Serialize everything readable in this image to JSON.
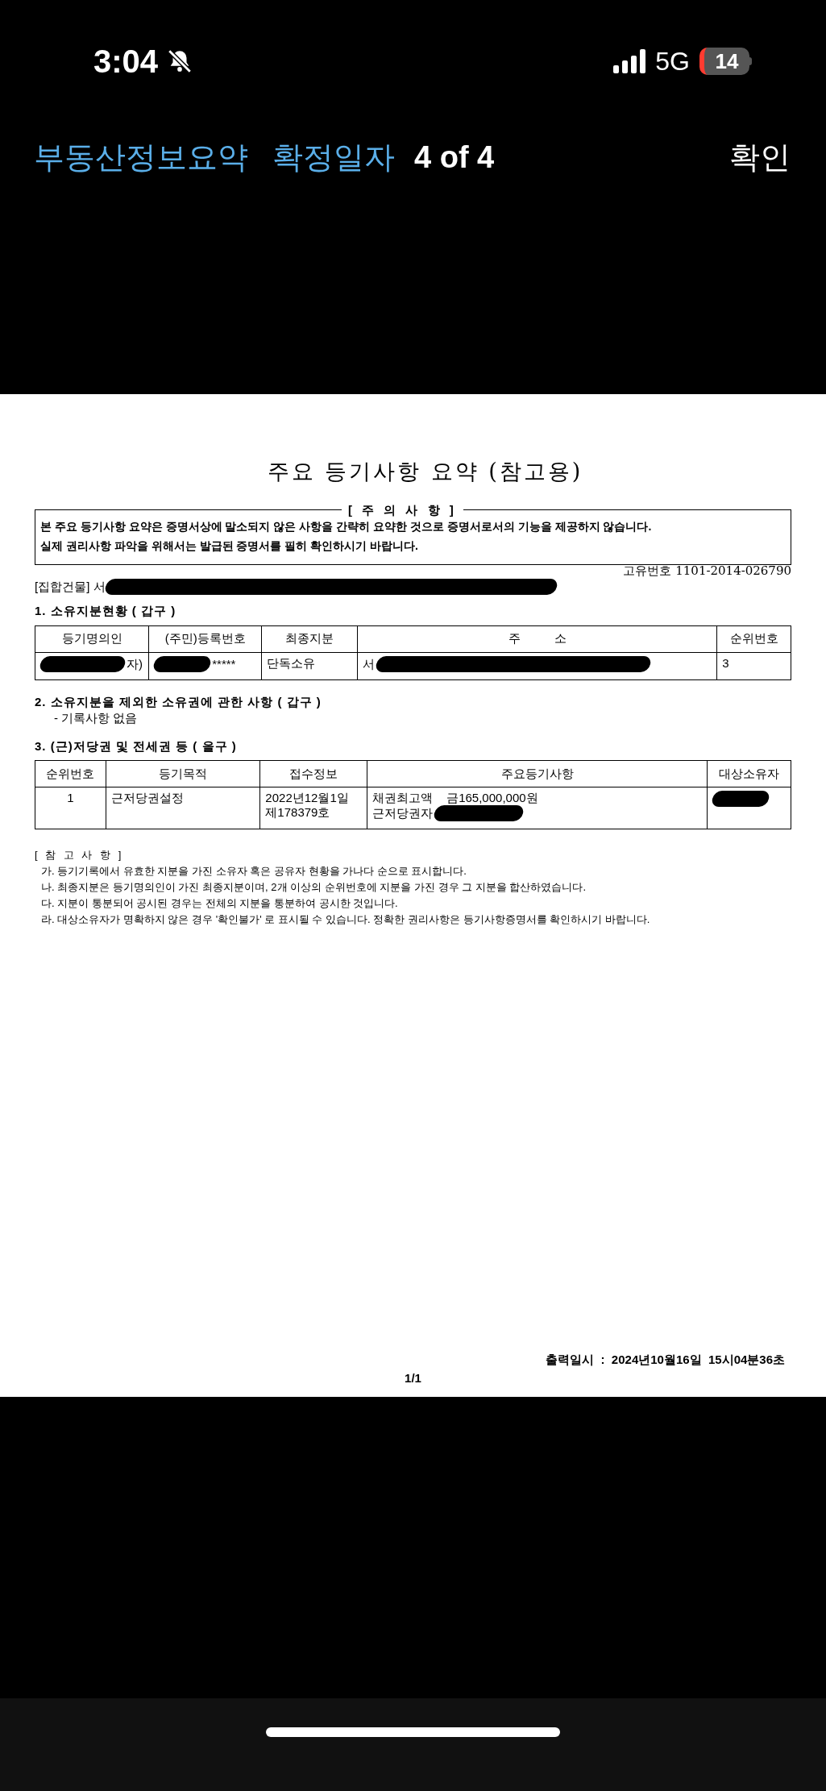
{
  "status_bar": {
    "time": "3:04",
    "muted": true,
    "network": "5G",
    "battery": "14"
  },
  "nav": {
    "title": "부동산정보요약",
    "subtitle": "확정일자",
    "page": "4 of 4",
    "action": "확인"
  },
  "document": {
    "title": "주요 등기사항 요약 (참고용)",
    "notice": {
      "heading": "[ 주 의 사 항 ]",
      "lines": [
        "본 주요 등기사항 요약은 증명서상에 말소되지 않은 사항을 간략히 요약한 것으로 증명서로서의 기능을 제공하지 않습니다.",
        "실제 권리사항 파악을 위해서는 발급된 증명서를 필히 확인하시기 바랍니다."
      ]
    },
    "building": {
      "text": "[집합건물] 서",
      "redacted": true
    },
    "unique_no": "고유번호 1101-2014-026790",
    "section_1": {
      "heading": "1. 소유지분현황 ( 갑구 )",
      "columns": [
        "등기명의인",
        "(주민)등록번호",
        "최종지분",
        "주          소",
        "순위번호"
      ],
      "rows": [
        [
          {
            "lines": [
              "자)"
            ],
            "redacted": true
          },
          {
            "lines": [
              "*****"
            ],
            "redacted": true
          },
          {
            "lines": [
              "단독소유"
            ],
            "redacted": false
          },
          {
            "lines": [
              "서"
            ],
            "redacted": true
          },
          {
            "lines": [
              "3"
            ],
            "redacted": false
          }
        ]
      ]
    },
    "section_2": {
      "heading": "2. 소유지분을 제외한 소유권에 관한 사항 ( 갑구 )",
      "note": "- 기록사항 없음"
    },
    "section_3": {
      "heading": "3. (근)저당권 및 전세권 등 ( 을구 )",
      "columns": [
        "순위번호",
        "등기목적",
        "접수정보",
        "주요등기사항",
        "대상소유자"
      ],
      "rows": [
        [
          {
            "lines": [
              "1"
            ],
            "redacted": false
          },
          {
            "lines": [
              "근저당권설정"
            ],
            "redacted": false
          },
          {
            "lines": [
              "2022년12월1일",
              "제178379호"
            ],
            "redacted": false
          },
          {
            "lines": [
              "채권최고액    금165,000,000원",
              "근저당권자"
            ],
            "redacted": true
          },
          {
            "redacted": true
          }
        ]
      ]
    },
    "notes": {
      "heading": "[ 참 고 사 항 ]",
      "items": [
        "가. 등기기록에서 유효한 지분을 가진 소유자 혹은 공유자 현황을 가나다 순으로 표시합니다.",
        "나. 최종지분은 등기명의인이 가진 최종지분이며, 2개 이상의 순위번호에 지분을 가진 경우 그 지분을 합산하였습니다.",
        "다. 지분이 통분되어 공시된 경우는 전체의 지분을 통분하여 공시한 것입니다.",
        "라. 대상소유자가 명확하지 않은 경우  '확인불가' 로 표시될 수 있습니다. 정확한 권리사항은 등기사항증명서를 확인하시기 바랍니다."
      ]
    },
    "print_time": "출력일시  :  2024년10월16일  15시04분36초",
    "page_no": "1/1"
  }
}
